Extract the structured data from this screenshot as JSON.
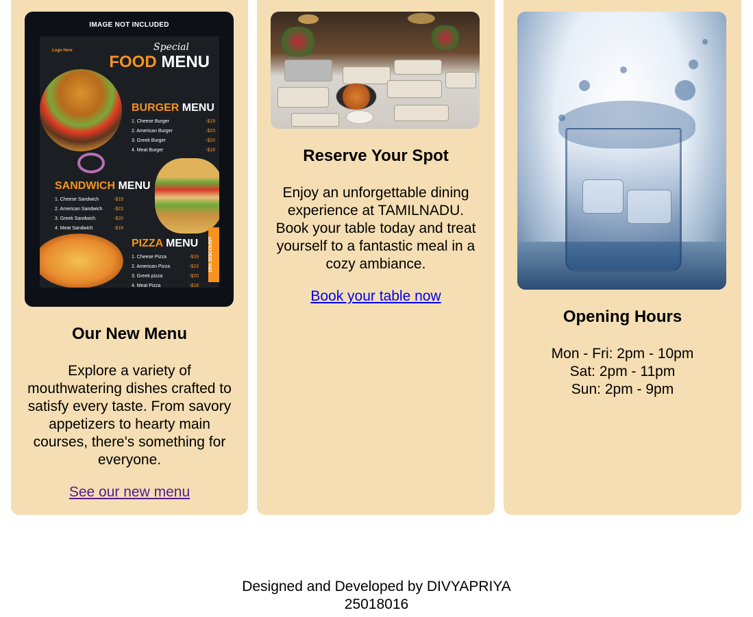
{
  "cards": [
    {
      "image_text": {
        "tag": "IMAGE NOT INCLUDED",
        "logo": "Logo Here",
        "special": "Special",
        "food": "FOOD",
        "menu": "MENU",
        "burger_title": [
          "BURGER",
          "MENU"
        ],
        "burger_items": [
          {
            "name": "1. Cheese Burger",
            "price": "-$19"
          },
          {
            "name": "2. American Burger",
            "price": "-$23"
          },
          {
            "name": "3. Greek Burger",
            "price": "-$20"
          },
          {
            "name": "4. Meat Burger",
            "price": "-$18"
          }
        ],
        "sandwich_title": [
          "SANDWICH",
          "MENU"
        ],
        "sandwich_items": [
          {
            "name": "1. Cheese Sandwich",
            "price": "-$19"
          },
          {
            "name": "2. American Sandwich",
            "price": "-$23"
          },
          {
            "name": "3. Greek Sandwich",
            "price": "-$20"
          },
          {
            "name": "4. Meat Sandwich",
            "price": "-$18"
          }
        ],
        "pizza_title": [
          "PIZZA",
          "MENU"
        ],
        "pizza_items": [
          {
            "name": "1. Cheese Pizza",
            "price": "-$19"
          },
          {
            "name": "2. American Pizza",
            "price": "-$23"
          },
          {
            "name": "3. Greek pizza",
            "price": "-$20"
          },
          {
            "name": "4. Meat Pizza",
            "price": "-$18"
          }
        ],
        "discount": "15% DISCOUNT"
      },
      "title": "Our New Menu",
      "body": "Explore a variety of mouthwatering dishes crafted to satisfy every taste. From savory appetizers to hearty main courses, there's something for everyone.",
      "link": "See our new menu"
    },
    {
      "title": "Reserve Your Spot",
      "body": "Enjoy an unforgettable dining experience at TAMILNADU. Book your table today and treat yourself to a fantastic meal in a cozy ambiance.",
      "link": "Book your table now"
    },
    {
      "title": "Opening Hours",
      "hours": [
        "Mon - Fri: 2pm - 10pm",
        "Sat: 2pm - 11pm",
        "Sun: 2pm - 9pm"
      ]
    }
  ],
  "footer": {
    "line1": "Designed and Developed by DIVYAPRIYA",
    "line2": "25018016"
  },
  "colors": {
    "card_bg": "#f5deb3",
    "visited_link": "#551a8b",
    "link": "#0000ee",
    "poster_accent": "#f7931e"
  }
}
